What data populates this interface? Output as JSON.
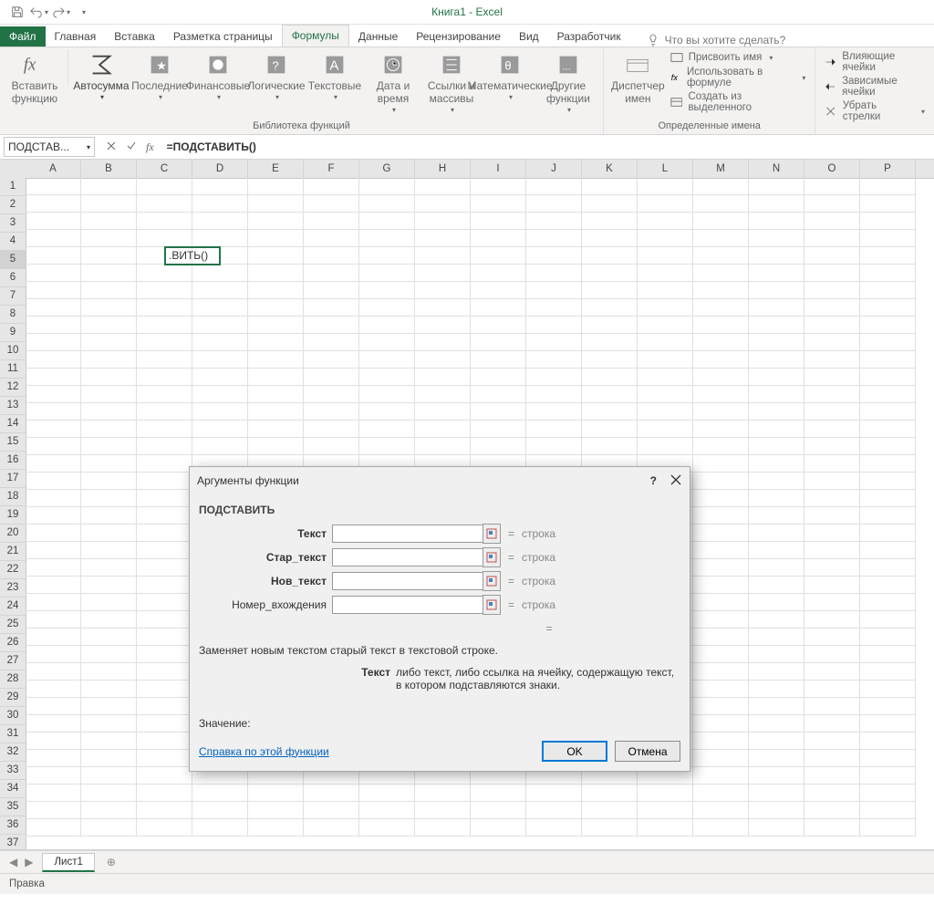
{
  "titlebar": {
    "title": "Книга1 - Excel"
  },
  "tabs": {
    "file": "Файл",
    "items": [
      "Главная",
      "Вставка",
      "Разметка страницы",
      "Формулы",
      "Данные",
      "Рецензирование",
      "Вид",
      "Разработчик"
    ],
    "active": "Формулы",
    "tell_me": "Что вы хотите сделать?"
  },
  "ribbon": {
    "insert_fn": "Вставить функцию",
    "autosum": "Автосумма",
    "recent": "Последние",
    "financial": "Финансовые",
    "logical": "Логические",
    "text": "Текстовые",
    "datetime": "Дата и время",
    "lookup": "Ссылки и массивы",
    "math": "Математические",
    "more": "Другие функции",
    "lib_label": "Библиотека функций",
    "name_mgr": "Диспетчер имен",
    "define": "Присвоить имя",
    "use_in": "Использовать в формуле",
    "create": "Создать из выделенного",
    "names_label": "Определенные имена",
    "trace_prec": "Влияющие ячейки",
    "trace_dep": "Зависимые ячейки",
    "remove_arr": "Убрать стрелки"
  },
  "formula_bar": {
    "name_box": "ПОДСТАВ...",
    "formula": "=ПОДСТАВИТЬ()"
  },
  "grid": {
    "cols": [
      "A",
      "B",
      "C",
      "D",
      "E",
      "F",
      "G",
      "H",
      "I",
      "J",
      "K",
      "L",
      "M",
      "N",
      "O",
      "P"
    ],
    "rows": 38,
    "active_row": 5,
    "active_col": 3,
    "cell_text": ".ВИТЬ()"
  },
  "dialog": {
    "title": "Аргументы функции",
    "fn": "ПОДСТАВИТЬ",
    "args": [
      {
        "label": "Текст",
        "bold": true,
        "type": "строка"
      },
      {
        "label": "Стар_текст",
        "bold": true,
        "type": "строка"
      },
      {
        "label": "Нов_текст",
        "bold": true,
        "type": "строка"
      },
      {
        "label": "Номер_вхождения",
        "bold": false,
        "type": "строка"
      }
    ],
    "eq": "=",
    "desc": "Заменяет новым текстом старый текст в текстовой строке.",
    "detail_label": "Текст",
    "detail_text": "либо текст, либо ссылка на ячейку, содержащую текст, в котором подставляются знаки.",
    "value_label": "Значение:",
    "help": "Справка по этой функции",
    "ok": "OK",
    "cancel": "Отмена"
  },
  "sheets": {
    "tab": "Лист1"
  },
  "status": {
    "mode": "Правка"
  }
}
